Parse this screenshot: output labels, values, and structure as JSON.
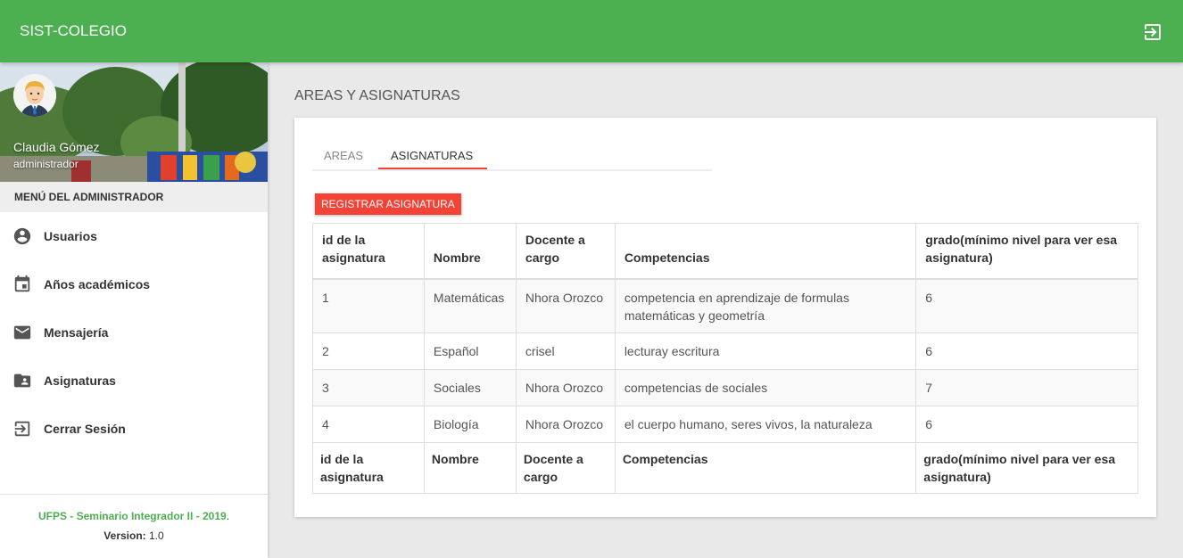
{
  "app": {
    "title": "SIST-COLEGIO",
    "logout_icon": "logout-icon"
  },
  "profile": {
    "name": "Claudia Gómez",
    "role": "administrador"
  },
  "sidebar": {
    "header": "MENÚ DEL ADMINISTRADOR",
    "items": [
      {
        "label": "Usuarios",
        "icon": "account-circle-icon"
      },
      {
        "label": "Años académicos",
        "icon": "calendar-icon"
      },
      {
        "label": "Mensajería",
        "icon": "mail-icon"
      },
      {
        "label": "Asignaturas",
        "icon": "folder-shared-icon"
      },
      {
        "label": "Cerrar Sesión",
        "icon": "exit-icon"
      }
    ],
    "footer": {
      "credit": "UFPS - Seminario Integrador II - 2019",
      "credit_end": ".",
      "version_label": "Version:",
      "version_value": "1.0"
    }
  },
  "main": {
    "page_title": "AREAS Y ASIGNATURAS",
    "tabs": [
      {
        "label": "AREAS"
      },
      {
        "label": "ASIGNATURAS"
      }
    ],
    "active_tab": "ASIGNATURAS",
    "register_button": "REGISTRAR ASIGNATURA",
    "table": {
      "columns": [
        "id de la asignatura",
        "Nombre",
        "Docente a cargo",
        "Competencias",
        "grado(mínimo nivel para ver esa asignatura)"
      ],
      "rows": [
        [
          "1",
          "Matemáticas",
          "Nhora Orozco",
          "competencia en aprendizaje de formulas matemáticas y geometría",
          "6"
        ],
        [
          "2",
          "Español",
          "crisel",
          "lecturay escritura",
          "6"
        ],
        [
          "3",
          "Sociales",
          "Nhora Orozco",
          "competencias de sociales",
          "7"
        ],
        [
          "4",
          "Biología",
          "Nhora Orozco",
          "el cuerpo humano, seres vivos, la naturaleza",
          "6"
        ]
      ]
    }
  },
  "colors": {
    "primary": "#4caf50",
    "accent": "#f44336"
  }
}
